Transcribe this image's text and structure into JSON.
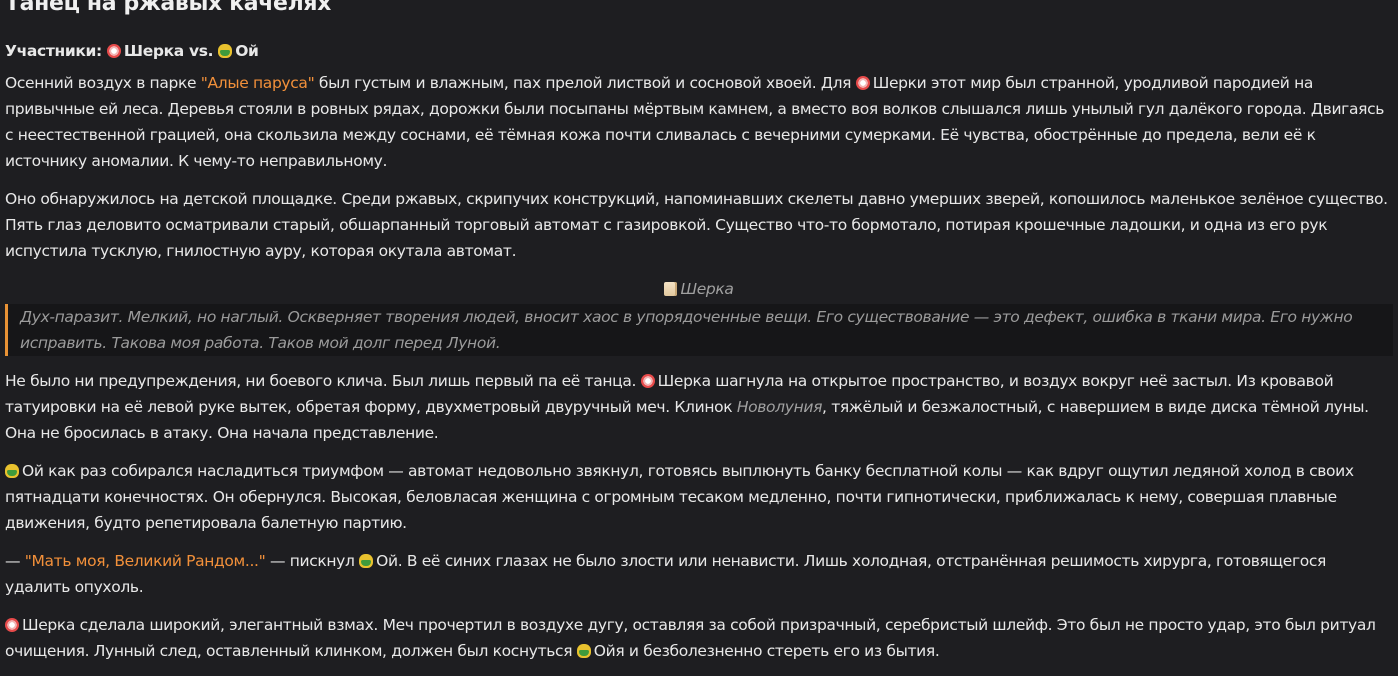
{
  "title": "Танец на ржавых качелях",
  "participants": {
    "label": "Участники:",
    "first": "Шерка",
    "vs": "vs.",
    "second": "Ой"
  },
  "icons": {
    "sherka": "red-circle-flower-emoji",
    "oy": "green-goblin-emoji",
    "scroll": "scroll-emoji"
  },
  "colors": {
    "background": "#1e1e21",
    "text": "#e8e8e8",
    "accent": "#f2903a",
    "quote_border": "#e89235"
  },
  "p1": {
    "a": "Осенний воздух в парке ",
    "park": "\"Алые паруса\"",
    "b": " был густым и влажным, пах прелой листвой и сосновой хвоей. Для ",
    "name": "Шерки",
    "c": " этот мир был странной, уродливой пародией на привычные ей леса. Деревья стояли в ровных рядах, дорожки были посыпаны мёртвым камнем, а вместо воя волков слышался лишь унылый гул далёкого города. Двигаясь с неестественной грацией, она скользила между соснами, её тёмная кожа почти сливалась с вечерними сумерками. Её чувства, обострённые до предела, вели её к источнику аномалии. К чему-то неправильному."
  },
  "p2": "Оно обнаружилось на детской площадке. Среди ржавых, скрипучих конструкций, напоминавших скелеты давно умерших зверей, копошилось маленькое зелёное существо. Пять глаз деловито осматривали старый, обшарпанный торговый автомат с газировкой. Существо что-то бормотало, потирая крошечные ладошки, и одна из его рук испустила тусклую, гнилостную ауру, которая окутала автомат.",
  "quote": {
    "author": "Шерка",
    "text": "Дух-паразит. Мелкий, но наглый. Оскверняет творения людей, вносит хаос в упорядоченные вещи. Его существование — это дефект, ошибка в ткани мира. Его нужно исправить. Такова моя работа. Таков мой долг перед Луной."
  },
  "p3": {
    "a": "Не было ни предупреждения, ни боевого клича. Был лишь первый па её танца. ",
    "name": "Шерка",
    "b": " шагнула на открытое пространство, и воздух вокруг неё застыл. Из кровавой татуировки на её левой руке вытек, обретая форму, двухметровый двуручный меч. Клинок ",
    "sword": "Новолуния",
    "c": ", тяжёлый и безжалостный, с навершием в виде диска тёмной луны. Она не бросилась в атаку. Она начала представление."
  },
  "p4": {
    "name": "Ой",
    "a": " как раз собирался насладиться триумфом — автомат недовольно звякнул, готовясь выплюнуть банку бесплатной колы — как вдруг ощутил ледяной холод в своих пятнадцати конечностях. Он обернулся. Высокая, беловласая женщина с огромным тесаком медленно, почти гипнотически, приближалась к нему, совершая плавные движения, будто репетировала балетную партию."
  },
  "p5": {
    "a": "— ",
    "speech": "\"Мать моя, Великий Рандом...\"",
    "b": " — пискнул ",
    "name": "Ой",
    "c": ". В её синих глазах не было злости или ненависти. Лишь холодная, отстранённая решимость хирурга, готовящегося удалить опухоль."
  },
  "p6": {
    "name": "Шерка",
    "a": " сделала широкий, элегантный взмах. Меч прочертил в воздухе дугу, оставляя за собой призрачный, серебристый шлейф. Это был не просто удар, это был ритуал очищения. Лунный след, оставленный клинком, должен был коснуться ",
    "name2": "Ойя",
    "b": " и безболезненно стереть его из бытия."
  }
}
